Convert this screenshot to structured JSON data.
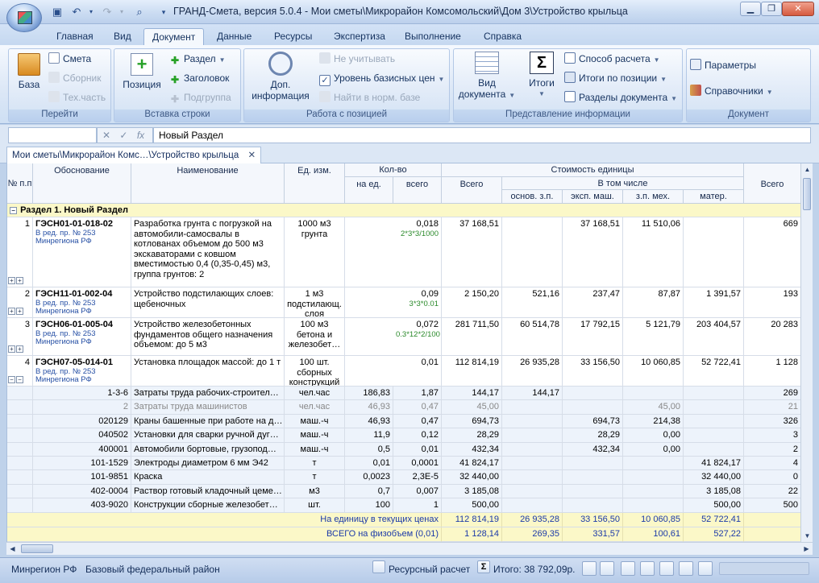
{
  "window": {
    "title": "ГРАНД-Смета, версия 5.0.4 - Мои сметы\\Микрорайон Комсомольский\\Дом 3\\Устройство крыльца"
  },
  "ribbon": {
    "tabs": [
      "Главная",
      "Вид",
      "Документ",
      "Данные",
      "Ресурсы",
      "Экспертиза",
      "Выполнение",
      "Справка"
    ],
    "active_tab": "Документ",
    "groups": {
      "go": {
        "label": "Перейти",
        "base": "База",
        "smeta": "Смета",
        "sbornik": "Сборник",
        "techpart": "Тех.часть"
      },
      "insert": {
        "label": "Вставка строки",
        "position": "Позиция",
        "section": "Раздел",
        "header": "Заголовок",
        "subgroup": "Подгруппа"
      },
      "work": {
        "label": "Работа с позицией",
        "addinfo_1": "Доп.",
        "addinfo_2": "информация",
        "ignore": "Не учитывать",
        "base_price_level": "Уровень базисных цен",
        "find_in_norm": "Найти в норм. базе"
      },
      "view": {
        "label": "Представление информации",
        "doc_view_1": "Вид",
        "doc_view_2": "документа",
        "totals": "Итоги",
        "calc_method": "Способ расчета",
        "totals_by_pos": "Итоги по позиции",
        "doc_sections": "Разделы документа"
      },
      "doc": {
        "label": "Документ",
        "params": "Параметры",
        "references": "Справочники"
      }
    }
  },
  "formula_bar": {
    "value": "Новый Раздел"
  },
  "doc_tab": {
    "label": "Мои сметы\\Микрорайон Комс…\\Устройство крыльца"
  },
  "grid": {
    "headers": {
      "num": "№ п.п",
      "basis": "Обоснование",
      "name": "Наименование",
      "unit": "Ед. изм.",
      "qty": "Кол-во",
      "qty_per": "на ед.",
      "qty_total": "всего",
      "unit_cost": "Стоимость единицы",
      "cost_total": "Всего",
      "incl": "В том числе",
      "salary": "основ. з.п.",
      "machines": "эксп. маш.",
      "mech_salary": "з.п. мех.",
      "materials": "матер.",
      "total": "Всего"
    },
    "section_title": "Раздел 1. Новый Раздел",
    "positions": [
      {
        "n": "1",
        "code": "ГЭСН01-01-018-02",
        "ed": "В ред. пр. № 253",
        "reg": "Минрегиона РФ",
        "name": "Разработка грунта с погрузкой на автомобили-самосвалы в котлованах объемом до 500 м3 экскаваторами с ковшом вместимостью 0,4 (0,35-0,45) м3, группа грунтов: 2",
        "unit": "1000 м3 грунта",
        "qty": "0,018",
        "formula": "2*3*3/1000",
        "cost": "37 168,51",
        "salary": "",
        "machines": "37 168,51",
        "mech": "11 510,06",
        "mat": "",
        "total": "669"
      },
      {
        "n": "2",
        "code": "ГЭСН11-01-002-04",
        "ed": "В ред. пр. № 253",
        "reg": "Минрегиона РФ",
        "name": "Устройство подстилающих слоев: щебеночных",
        "unit": "1 м3 подстилающ. слоя",
        "qty": "0,09",
        "formula": "3*3*0.01",
        "cost": "2 150,20",
        "salary": "521,16",
        "machines": "237,47",
        "mech": "87,87",
        "mat": "1 391,57",
        "total": "193"
      },
      {
        "n": "3",
        "code": "ГЭСН06-01-005-04",
        "ed": "В ред. пр. № 253",
        "reg": "Минрегиона РФ",
        "name": "Устройство железобетонных фундаментов общего назначения объемом: до 5 м3",
        "unit": "100 м3 бетона и железобет…",
        "qty": "0,072",
        "formula": "0.3*12*2/100",
        "cost": "281 711,50",
        "salary": "60 514,78",
        "machines": "17 792,15",
        "mech": "5 121,79",
        "mat": "203 404,57",
        "total": "20 283"
      },
      {
        "n": "4",
        "code": "ГЭСН07-05-014-01",
        "ed": "В ред. пр. № 253",
        "reg": "Минрегиона РФ",
        "name": "Установка площадок массой: до 1 т",
        "unit": "100 шт. сборных конструкций",
        "qty": "0,01",
        "formula": "",
        "cost": "112 814,19",
        "salary": "26 935,28",
        "machines": "33 156,50",
        "mech": "10 060,85",
        "mat": "52 722,41",
        "total": "1 128"
      }
    ],
    "resources": [
      {
        "code": "1-3-6",
        "name": "Затраты труда рабочих-строител…",
        "unit": "чел.час",
        "per": "186,83",
        "qty": "1,87",
        "cost": "144,17",
        "salary": "144,17",
        "machines": "",
        "mech": "",
        "mat": "",
        "total": "269"
      },
      {
        "code": "2",
        "name": "Затраты труда машинистов",
        "unit": "чел.час",
        "per": "46,93",
        "qty": "0,47",
        "cost": "45,00",
        "salary": "",
        "machines": "",
        "mech": "45,00",
        "mat": "",
        "total": "21"
      },
      {
        "code": "020129",
        "name": "Краны башенные при работе на д…",
        "unit": "маш.-ч",
        "per": "46,93",
        "qty": "0,47",
        "cost": "694,73",
        "salary": "",
        "machines": "694,73",
        "mech": "214,38",
        "mat": "",
        "total": "326"
      },
      {
        "code": "040502",
        "name": "Установки для сварки ручной дуг…",
        "unit": "маш.-ч",
        "per": "11,9",
        "qty": "0,12",
        "cost": "28,29",
        "salary": "",
        "machines": "28,29",
        "mech": "0,00",
        "mat": "",
        "total": "3"
      },
      {
        "code": "400001",
        "name": "Автомобили бортовые, грузопод…",
        "unit": "маш.-ч",
        "per": "0,5",
        "qty": "0,01",
        "cost": "432,34",
        "salary": "",
        "machines": "432,34",
        "mech": "0,00",
        "mat": "",
        "total": "2"
      },
      {
        "code": "101-1529",
        "name": "Электроды диаметром 6 мм Э42",
        "unit": "т",
        "per": "0,01",
        "qty": "0,0001",
        "cost": "41 824,17",
        "salary": "",
        "machines": "",
        "mech": "",
        "mat": "41 824,17",
        "total": "4"
      },
      {
        "code": "101-9851",
        "name": "Краска",
        "unit": "т",
        "per": "0,0023",
        "qty": "2,3Е-5",
        "cost": "32 440,00",
        "salary": "",
        "machines": "",
        "mech": "",
        "mat": "32 440,00",
        "total": "0"
      },
      {
        "code": "402-0004",
        "name": "Раствор готовый кладочный цеме…",
        "unit": "м3",
        "per": "0,7",
        "qty": "0,007",
        "cost": "3 185,08",
        "salary": "",
        "machines": "",
        "mech": "",
        "mat": "3 185,08",
        "total": "22"
      },
      {
        "code": "403-9020",
        "name": "Конструкции сборные железобет…",
        "unit": "шт.",
        "per": "100",
        "qty": "1",
        "cost": "500,00",
        "salary": "",
        "machines": "",
        "mech": "",
        "mat": "500,00",
        "total": "500"
      }
    ],
    "totals": [
      {
        "label": "На единицу в текущих ценах",
        "cost": "112 814,19",
        "salary": "26 935,28",
        "machines": "33 156,50",
        "mech": "10 060,85",
        "mat": "52 722,41"
      },
      {
        "label": "ВСЕГО на физобъем (0,01)",
        "cost": "1 128,14",
        "salary": "269,35",
        "machines": "331,57",
        "mech": "100,61",
        "mat": "527,22"
      }
    ]
  },
  "statusbar": {
    "region": "Минрегион РФ",
    "district": "Базовый федеральный район",
    "calc_mode": "Ресурсный расчет",
    "total": "Итого: 38 792,09р."
  }
}
